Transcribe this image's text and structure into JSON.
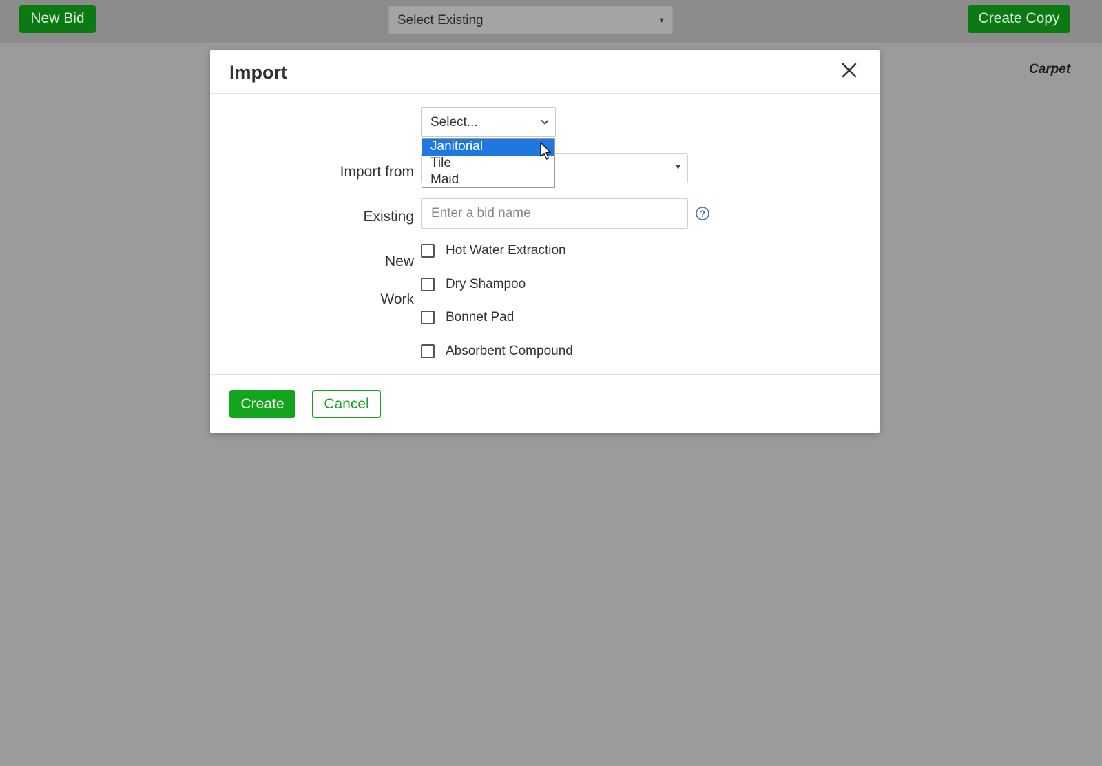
{
  "topbar": {
    "new_bid_label": "New Bid",
    "select_existing_value": "Select Existing",
    "create_copy_label": "Create Copy",
    "service_label": "Carpet"
  },
  "modal": {
    "title": "Import",
    "import_from": {
      "label": "Import from",
      "selected": "Select...",
      "options": [
        "Janitorial",
        "Tile",
        "Maid"
      ],
      "highlighted": "Janitorial"
    },
    "existing": {
      "label": "Existing",
      "value": ""
    },
    "new": {
      "label": "New",
      "placeholder": "Enter a bid name",
      "value": ""
    },
    "work": {
      "label": "Work",
      "items": [
        {
          "label": "Hot Water Extraction",
          "checked": false
        },
        {
          "label": "Dry Shampoo",
          "checked": false
        },
        {
          "label": "Bonnet Pad",
          "checked": false
        },
        {
          "label": "Absorbent Compound",
          "checked": false
        }
      ]
    },
    "footer": {
      "create_label": "Create",
      "cancel_label": "Cancel"
    }
  },
  "colors": {
    "primary_green": "#13a61c",
    "dim_green": "#0c7a13",
    "highlight_blue": "#1e78e0",
    "overlay_gray": "#9b9b9b"
  },
  "icons": [
    "close-icon",
    "chevron-down-icon",
    "help-icon",
    "mouse-cursor-icon"
  ]
}
